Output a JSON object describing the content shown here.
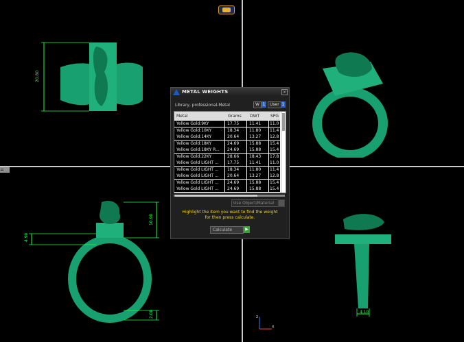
{
  "colors": {
    "ring": "#18a070",
    "dim": "#20ff40",
    "panel_bg": "#202020",
    "hint": "#f2d21b"
  },
  "side_tab": {
    "label": "="
  },
  "viewports": {
    "top_left": {
      "dim_label": "20.80"
    },
    "bottom_left": {
      "dim_label_top": "10.90",
      "dim_label_mid": "4.90",
      "dim_label_bottom": "2.00"
    },
    "bottom_right": {
      "dim_label": "4.10"
    },
    "axis": {
      "x_label": "x",
      "z_label": "z"
    }
  },
  "dialog": {
    "title": "METAL WEIGHTS",
    "close_icon": "x",
    "library_label": "Library, professional-Metal",
    "unit_weight": "W",
    "unit_user": "User",
    "unit_btn1": "1",
    "unit_btn2": "1",
    "columns": [
      "Metal",
      "Grams",
      "DWT",
      "SPG"
    ],
    "rows": [
      [
        "Yellow Gold:9KY",
        "17.75",
        "11.41",
        "11.0"
      ],
      [
        "Yellow Gold:10KY",
        "18.34",
        "11.80",
        "11.4"
      ],
      [
        "Yellow Gold:14KY",
        "20.64",
        "13.27",
        "12.8"
      ],
      [
        "Yellow Gold:18KY",
        "24.69",
        "15.88",
        "15.4"
      ],
      [
        "Yellow Gold:18KY R...",
        "24.69",
        "15.88",
        "15.4"
      ],
      [
        "Yellow Gold:22KY",
        "28.66",
        "18.43",
        "17.8"
      ],
      [
        "Yellow Gold LIGHT ...",
        "17.75",
        "11.41",
        "11.0"
      ],
      [
        "Yellow Gold LIGHT ...",
        "18.34",
        "11.80",
        "11.4"
      ],
      [
        "Yellow Gold LIGHT ...",
        "20.64",
        "13.27",
        "12.8"
      ],
      [
        "Yellow Gold LIGHT ...",
        "24.69",
        "15.88",
        "15.4"
      ],
      [
        "Yellow Gold LIGHT ...",
        "24.69",
        "15.88",
        "15.4"
      ]
    ],
    "use_object_placeholder": "Use Object/Material",
    "hint_line1": "Highlight the item you want to find the weight",
    "hint_line2": "for then press calculate.",
    "calculate_label": "Calculate",
    "calculate_icon": "play-icon"
  }
}
